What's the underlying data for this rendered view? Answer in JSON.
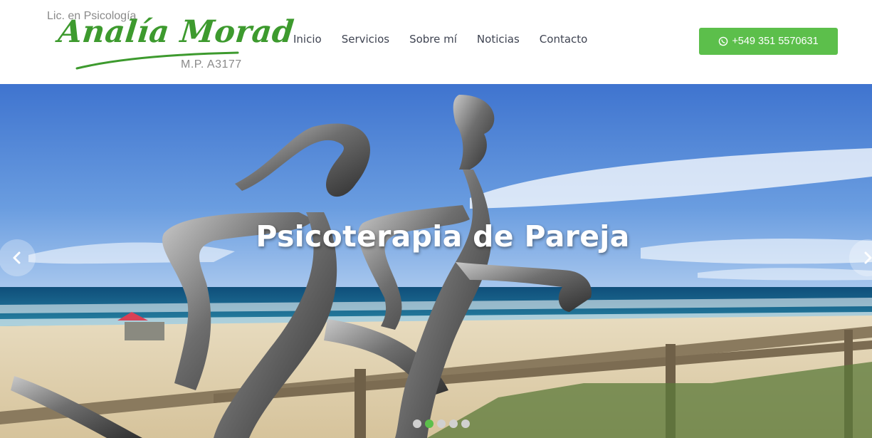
{
  "logo": {
    "pretitle": "Lic. en Psicología",
    "name": "Analía Morad",
    "registration": "M.P. A3177"
  },
  "nav": {
    "items": [
      {
        "label": "Inicio"
      },
      {
        "label": "Servicios"
      },
      {
        "label": "Sobre mí"
      },
      {
        "label": "Noticias"
      },
      {
        "label": "Contacto"
      }
    ]
  },
  "contact_button": {
    "icon": "whatsapp-icon",
    "label": "+549 351 5570631"
  },
  "hero": {
    "title": "Psicoterapia de Pareja",
    "prev_icon": "chevron-left-icon",
    "next_icon": "chevron-right-icon",
    "slide_count": 5,
    "active_slide": 2
  },
  "colors": {
    "accent": "#5cbf4b",
    "logo_green": "#3d9a2e",
    "nav_text": "#3f4452"
  }
}
